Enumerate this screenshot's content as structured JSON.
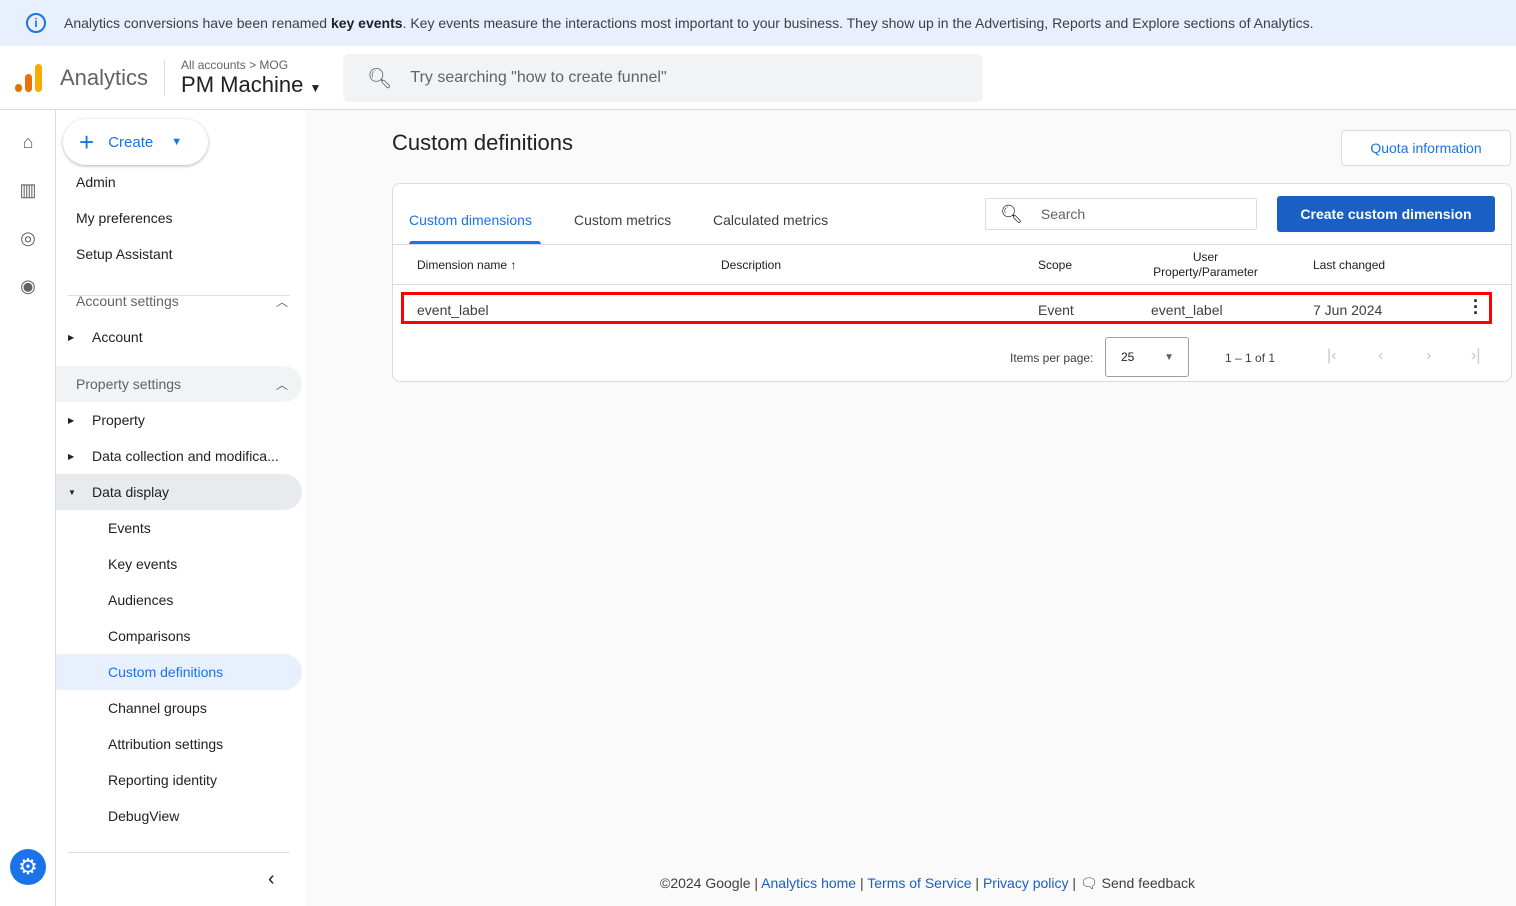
{
  "banner": {
    "pre": "Analytics conversions have been renamed ",
    "bold": "key events",
    "post": ". Key events measure the interactions most important to your business. They show up in the Advertising, Reports and Explore sections of Analytics."
  },
  "header": {
    "app": "Analytics",
    "crumb": "All accounts > MOG",
    "property": "PM Machine",
    "search_placeholder": "Try searching \"how to create funnel\""
  },
  "colors": {
    "accent": "#1a73e8",
    "highlight": "#ff0000"
  },
  "sidebar": {
    "create": "Create",
    "items": [
      {
        "label": "Admin",
        "level": 0
      },
      {
        "label": "My preferences",
        "level": 0
      },
      {
        "label": "Setup Assistant",
        "level": 0
      },
      {
        "label": "Account settings",
        "section": true
      },
      {
        "label": "Account",
        "level": 1
      },
      {
        "label": "Property settings",
        "section": true
      },
      {
        "label": "Property",
        "level": 1
      },
      {
        "label": "Data collection and modifica...",
        "level": 1
      },
      {
        "label": "Data display",
        "level": 1,
        "open": true
      },
      {
        "label": "Events",
        "level": 2
      },
      {
        "label": "Key events",
        "level": 2
      },
      {
        "label": "Audiences",
        "level": 2
      },
      {
        "label": "Comparisons",
        "level": 2
      },
      {
        "label": "Custom definitions",
        "level": 2,
        "selected": true
      },
      {
        "label": "Channel groups",
        "level": 2
      },
      {
        "label": "Attribution settings",
        "level": 2
      },
      {
        "label": "Reporting identity",
        "level": 2
      },
      {
        "label": "DebugView",
        "level": 2
      }
    ]
  },
  "main": {
    "title": "Custom definitions",
    "quota": "Quota information",
    "tabs": [
      "Custom dimensions",
      "Custom metrics",
      "Calculated metrics"
    ],
    "search_placeholder": "Search",
    "create_button": "Create custom dimension",
    "columns": [
      "Dimension name",
      "Description",
      "Scope",
      "User Property/Parameter",
      "Last changed"
    ],
    "rows": [
      {
        "name": "event_label",
        "description": "",
        "scope": "Event",
        "param": "event_label",
        "changed": "7 Jun 2024"
      }
    ],
    "items_per_page_label": "Items per page:",
    "items_per_page": "25",
    "range": "1 – 1 of 1"
  },
  "footer": {
    "copy": "©2024 Google",
    "links": [
      "Analytics home",
      "Terms of Service",
      "Privacy policy"
    ],
    "feedback": "Send feedback"
  }
}
